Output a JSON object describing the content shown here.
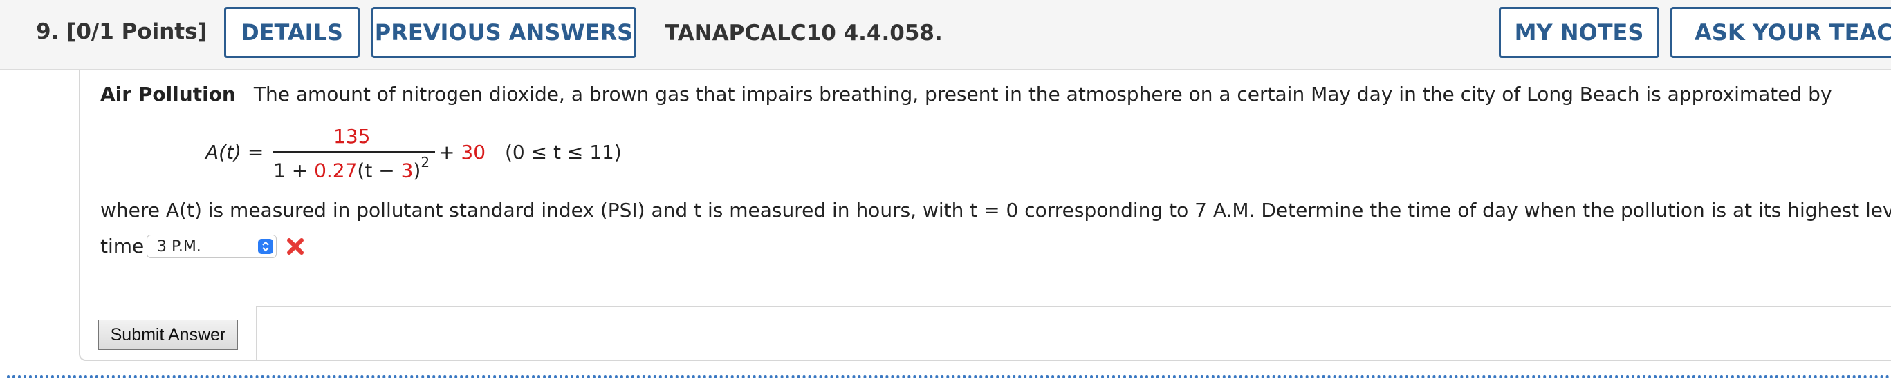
{
  "header": {
    "question_number": "9.",
    "points": "[0/1 Points]",
    "details_label": "DETAILS",
    "previous_answers_label": "PREVIOUS ANSWERS",
    "question_code": "TANAPCALC10 4.4.058.",
    "my_notes_label": "MY NOTES",
    "ask_teacher_label": "ASK YOUR TEACHE"
  },
  "problem": {
    "title": "Air Pollution",
    "intro": "The amount of nitrogen dioxide, a brown gas that impairs breathing, present in the atmosphere on a certain May day in the city of Long Beach is approximated by",
    "formula": {
      "lhs": "A(t) =",
      "numerator": "135",
      "denominator_prefix": "1 + ",
      "denominator_coef": "0.27",
      "denominator_mid": "(t − ",
      "denominator_shift": "3",
      "denominator_suffix": ")",
      "exponent": "2",
      "plus": "+ ",
      "constant": "30",
      "domain": "(0 ≤ t ≤ 11)"
    },
    "where_text": "where A(t) is measured in pollutant standard index (PSI) and t is measured in hours, with t = 0 corresponding to 7 A.M. Determine the time of day when the pollution is at its highest level."
  },
  "answer": {
    "label": "time",
    "selected_value": "3 P.M.",
    "status": "incorrect",
    "status_icon": "x-icon",
    "status_color": "#e53935"
  },
  "submit_label": "Submit Answer",
  "colors": {
    "accent": "#2b5c8f",
    "highlight": "#d81b1b",
    "select_arrow": "#2a7cf6"
  }
}
